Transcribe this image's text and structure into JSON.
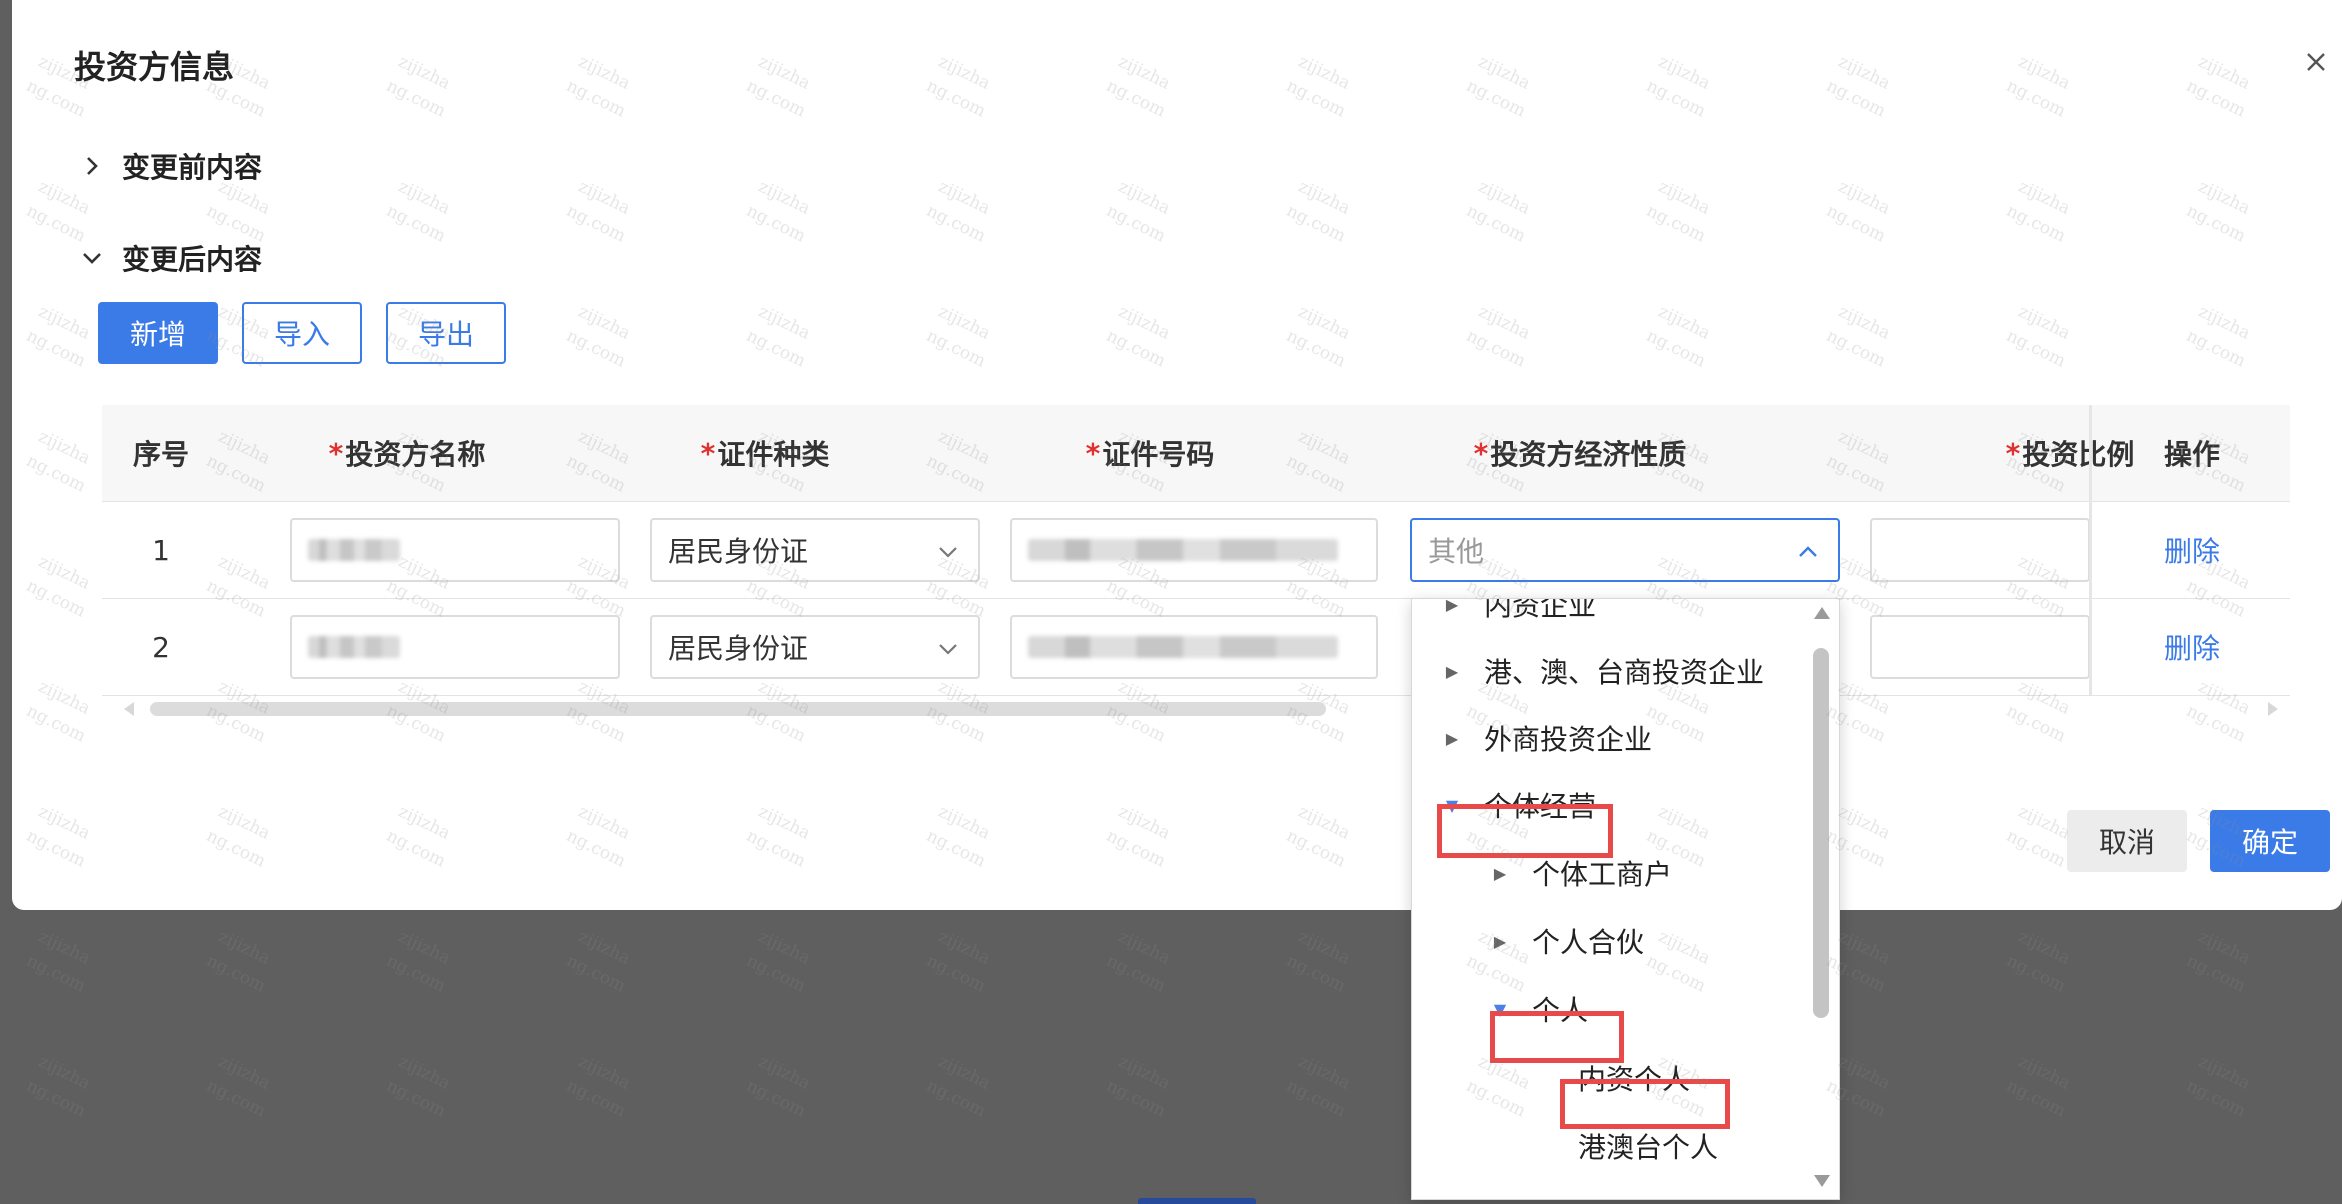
{
  "dialog": {
    "title": "投资方信息",
    "close_icon": "close-icon"
  },
  "sections": {
    "before": {
      "label": "变更前内容",
      "icon": "chevron-right-icon",
      "expanded": false
    },
    "after": {
      "label": "变更后内容",
      "icon": "chevron-down-icon",
      "expanded": true
    }
  },
  "toolbar": {
    "add_label": "新增",
    "import_label": "导入",
    "export_label": "导出"
  },
  "table": {
    "columns": {
      "index": "序号",
      "name": "投资方名称",
      "id_type": "证件种类",
      "id_number": "证件号码",
      "nature": "投资方经济性质",
      "ratio": "投资比例",
      "action": "操作"
    },
    "required_mark": "*",
    "rows": [
      {
        "index": "1",
        "id_type": "居民身份证",
        "nature_placeholder": "其他",
        "action": "删除"
      },
      {
        "index": "2",
        "id_type": "居民身份证",
        "action": "删除"
      }
    ]
  },
  "footer": {
    "cancel_label": "取消",
    "ok_label": "确定"
  },
  "dropdown": {
    "items": [
      {
        "label": "内资企业",
        "state": "collapsed"
      },
      {
        "label": "港、澳、台商投资企业",
        "state": "collapsed"
      },
      {
        "label": "外商投资企业",
        "state": "collapsed"
      },
      {
        "label": "个体经营",
        "state": "expanded"
      },
      {
        "label": "个体工商户",
        "state": "collapsed"
      },
      {
        "label": "个人合伙",
        "state": "collapsed"
      },
      {
        "label": "个人",
        "state": "expanded"
      },
      {
        "label": "内资个人",
        "state": "leaf"
      },
      {
        "label": "港澳台个人",
        "state": "leaf"
      }
    ]
  },
  "colors": {
    "primary": "#3b7be8",
    "required": "#e03030",
    "highlight_box": "#e84a4a",
    "overlay": "#5f5f5f"
  },
  "watermark_text": "zijizhang.com"
}
